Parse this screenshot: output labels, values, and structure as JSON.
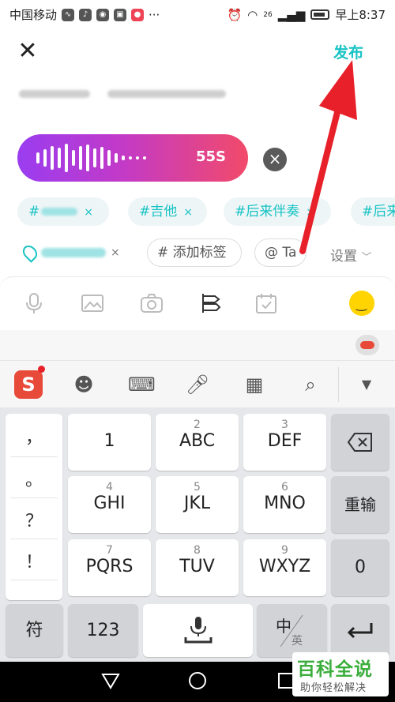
{
  "status_bar": {
    "carrier": "中国移动",
    "time": "早上8:37",
    "signal_label": "26"
  },
  "header": {
    "publish_label": "发布"
  },
  "voice": {
    "duration": "55S",
    "wave_heights": [
      14,
      22,
      30,
      26,
      36,
      20,
      30,
      34,
      24,
      28,
      20,
      12,
      6,
      4,
      4,
      4
    ]
  },
  "tags": [
    {
      "label": "#",
      "has_close": true
    },
    {
      "label": "#吉他",
      "has_close": true
    },
    {
      "label": "#后来伴奏",
      "has_close": true
    },
    {
      "label": "#后来",
      "has_close": false
    }
  ],
  "chips": {
    "add_tag": "添加标签",
    "mention": "Ta",
    "settings": "设置"
  },
  "keyboard": {
    "punctuation": [
      "，",
      "。",
      "？",
      "！"
    ],
    "rows": [
      [
        {
          "num": "",
          "letters": "1"
        },
        {
          "num": "2",
          "letters": "ABC"
        },
        {
          "num": "3",
          "letters": "DEF"
        }
      ],
      [
        {
          "num": "4",
          "letters": "GHI"
        },
        {
          "num": "5",
          "letters": "JKL"
        },
        {
          "num": "6",
          "letters": "MNO"
        }
      ],
      [
        {
          "num": "7",
          "letters": "PQRS"
        },
        {
          "num": "8",
          "letters": "TUV"
        },
        {
          "num": "9",
          "letters": "WXYZ"
        }
      ]
    ],
    "reenter": "重输",
    "zero": "0",
    "symbols": "符",
    "numbers": "123",
    "lang_main": "中",
    "lang_sub": "英"
  },
  "watermark": {
    "title": "百科全说",
    "subtitle": "助你轻松解决"
  },
  "colors": {
    "accent": "#17c3c4",
    "arrow": "#e8202a"
  }
}
